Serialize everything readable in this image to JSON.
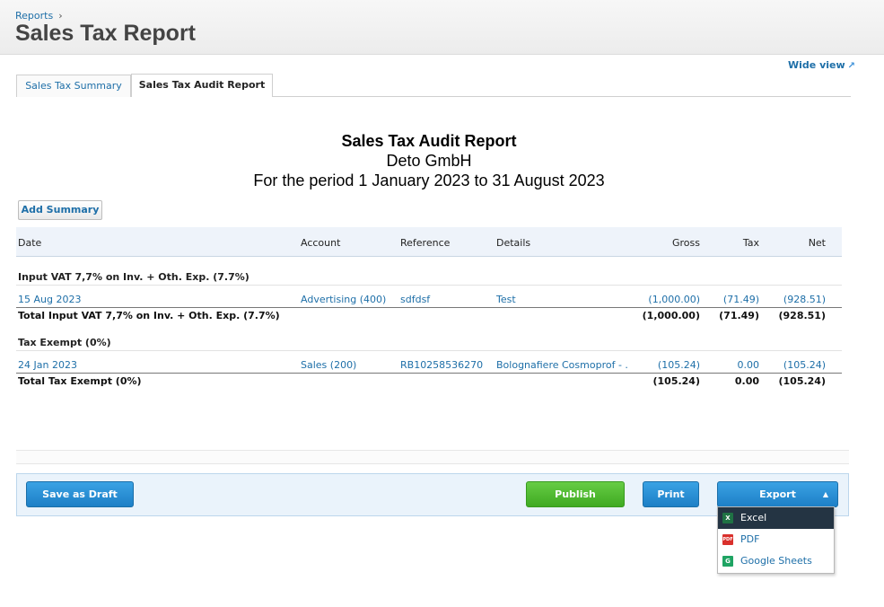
{
  "breadcrumb": {
    "parent": "Reports",
    "separator": "›"
  },
  "page_title": "Sales Tax Report",
  "wide_view_label": "Wide view",
  "tabs": [
    {
      "label": "Sales Tax Summary",
      "active": false
    },
    {
      "label": "Sales Tax Audit Report",
      "active": true
    }
  ],
  "report": {
    "title": "Sales Tax Audit Report",
    "company": "Deto GmbH",
    "period": "For the period 1 January 2023 to 31 August 2023"
  },
  "add_summary_label": "Add Summary",
  "columns": {
    "date": "Date",
    "account": "Account",
    "reference": "Reference",
    "details": "Details",
    "gross": "Gross",
    "tax": "Tax",
    "net": "Net"
  },
  "groups": [
    {
      "title": "Input VAT 7,7% on Inv. + Oth. Exp. (7.7%)",
      "row": {
        "date": "15 Aug 2023",
        "account": "Advertising (400)",
        "reference": "sdfdsf",
        "details": "Test",
        "gross": "(1,000.00)",
        "tax": "(71.49)",
        "net": "(928.51)"
      },
      "total": {
        "label": "Total Input VAT 7,7% on Inv. + Oth. Exp. (7.7%)",
        "gross": "(1,000.00)",
        "tax": "(71.49)",
        "net": "(928.51)"
      }
    },
    {
      "title": "Tax Exempt (0%)",
      "row": {
        "date": "24 Jan 2023",
        "account": "Sales (200)",
        "reference": "RB10258536270",
        "details": "Bolognafiere Cosmoprof - .",
        "gross": "(105.24)",
        "tax": "0.00",
        "net": "(105.24)"
      },
      "total": {
        "label": "Total Tax Exempt (0%)",
        "gross": "(105.24)",
        "tax": "0.00",
        "net": "(105.24)"
      }
    }
  ],
  "footer": {
    "save_draft": "Save as Draft",
    "publish": "Publish",
    "print": "Print",
    "export": "Export"
  },
  "export_menu": [
    {
      "label": "Excel",
      "icon": "excel-icon",
      "icon_glyph": "X"
    },
    {
      "label": "PDF",
      "icon": "pdf-icon",
      "icon_glyph": "PDF"
    },
    {
      "label": "Google Sheets",
      "icon": "google-sheets-icon",
      "icon_glyph": "G"
    }
  ]
}
